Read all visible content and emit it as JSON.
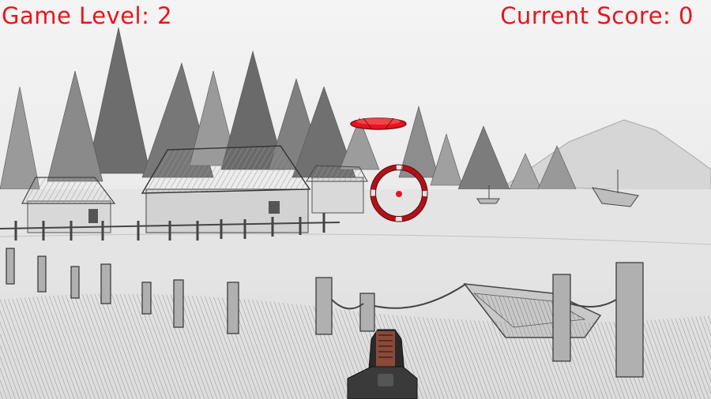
{
  "hud": {
    "level_label": "Game Level:",
    "level_value": "2",
    "score_label": "Current Score:",
    "score_value": "0"
  },
  "colors": {
    "hud_text": "#e8141c",
    "crosshair": "#b01218",
    "target": "#e8141c"
  },
  "icons": {
    "crosshair": "crosshair-reticle-icon",
    "target": "flying-disc-target-icon",
    "weapon": "shotgun-icon"
  }
}
